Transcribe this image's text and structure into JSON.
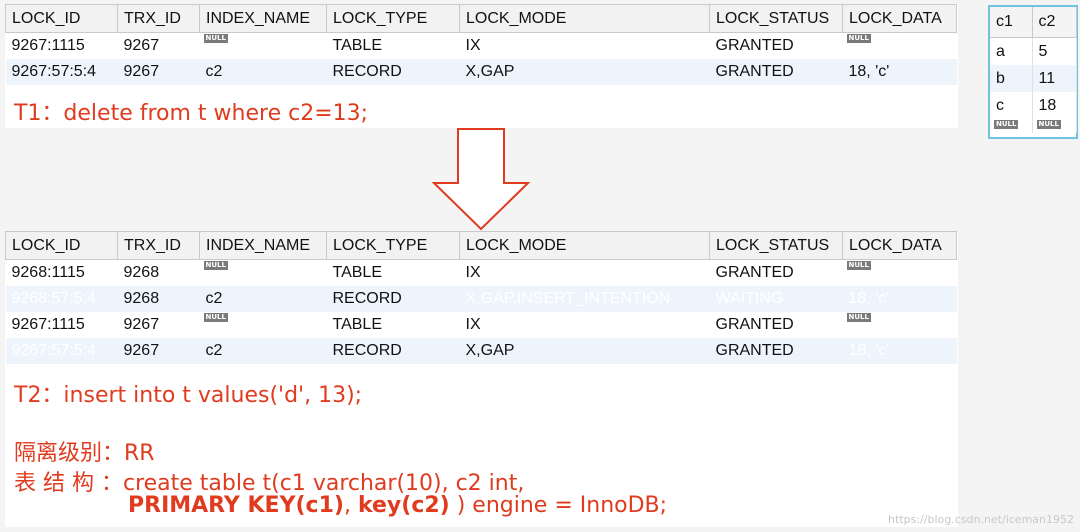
{
  "null_label": "NULL",
  "columns": [
    "LOCK_ID",
    "TRX_ID",
    "INDEX_NAME",
    "LOCK_TYPE",
    "LOCK_MODE",
    "LOCK_STATUS",
    "LOCK_DATA"
  ],
  "table1": {
    "rows": [
      {
        "lock_id": "9267:1115",
        "trx_id": "9267",
        "index_name": null,
        "lock_type": "TABLE",
        "lock_mode": "IX",
        "lock_status": "GRANTED",
        "lock_data": null
      },
      {
        "lock_id": "9267:57:5:4",
        "trx_id": "9267",
        "index_name": "c2",
        "lock_type": "RECORD",
        "lock_mode": "X,GAP",
        "lock_status": "GRANTED",
        "lock_data": "18, 'c'"
      }
    ]
  },
  "caption1": "T1：delete from t where c2=13;",
  "table2": {
    "rows": [
      {
        "lock_id": "9268:1115",
        "trx_id": "9268",
        "index_name": null,
        "lock_type": "TABLE",
        "lock_mode": "IX",
        "lock_status": "GRANTED",
        "lock_data": null
      },
      {
        "lock_id": "9268:57:5:4",
        "trx_id": "9268",
        "index_name": "c2",
        "lock_type": "RECORD",
        "lock_mode": "X,GAP,INSERT_INTENTION",
        "lock_status": "WAITING",
        "lock_data": "18, 'c'"
      },
      {
        "lock_id": "9267:1115",
        "trx_id": "9267",
        "index_name": null,
        "lock_type": "TABLE",
        "lock_mode": "IX",
        "lock_status": "GRANTED",
        "lock_data": null
      },
      {
        "lock_id": "9267:57:5:4",
        "trx_id": "9267",
        "index_name": "c2",
        "lock_type": "RECORD",
        "lock_mode": "X,GAP",
        "lock_status": "GRANTED",
        "lock_data": "18, 'c'"
      }
    ]
  },
  "caption2": "T2：insert into t values('d', 13);",
  "isolation_line": "隔离级别：RR",
  "schema_line1": "表 结 构 ：create table t(c1 varchar(10), c2 int,",
  "schema_line2": {
    "pk": "PRIMARY KEY(c1)",
    "sep": ", ",
    "key": "key(c2)",
    "rest": " ) engine = InnoDB;"
  },
  "mini_table": {
    "columns": [
      "c1",
      "c2"
    ],
    "rows": [
      [
        "a",
        "5"
      ],
      [
        "b",
        "11"
      ],
      [
        "c",
        "18"
      ]
    ]
  },
  "watermark": "https://blog.csdn.net/iceman1952",
  "colors": {
    "selection": "#0a78d7",
    "caption": "#e03b1f",
    "arrow": "#e03b1f",
    "mini_border": "#6fc3e0"
  }
}
